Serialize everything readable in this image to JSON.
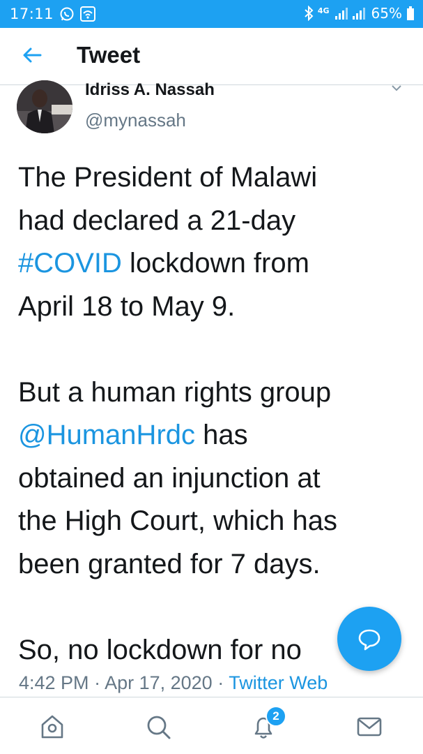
{
  "status_bar": {
    "time": "17:11",
    "network": "4G",
    "battery": "65%",
    "icons": [
      "whatsapp-icon",
      "wifi-icon",
      "bluetooth-icon",
      "signal-icon",
      "battery-icon"
    ]
  },
  "header": {
    "title": "Tweet",
    "back_icon": "back-arrow-icon"
  },
  "tweet": {
    "author": {
      "display_name": "Idriss A. Nassah",
      "handle": "@mynassah"
    },
    "body": {
      "p1_line1": "The President of Malawi",
      "p1_line2": "had declared a 21-day",
      "p1_hashtag": "#COVID",
      "p1_line3_rest": " lockdown from",
      "p1_line4": "April 18 to May 9.",
      "p2_line1": "But a human rights group",
      "p2_mention": "@HumanHrdc",
      "p2_line2_rest": " has",
      "p2_line3": "obtained an injunction at",
      "p2_line4": "the High Court, which has",
      "p2_line5": "been granted for 7 days.",
      "p3_line1": "So, no lockdown for no"
    },
    "time": "4:42 PM",
    "date": "Apr 17, 2020",
    "separator": " · ",
    "source": "Twitter Web"
  },
  "bottom_nav": {
    "items": [
      {
        "name": "home",
        "icon": "home-icon"
      },
      {
        "name": "search",
        "icon": "search-icon"
      },
      {
        "name": "notifications",
        "icon": "bell-icon"
      },
      {
        "name": "messages",
        "icon": "mail-icon"
      }
    ],
    "notifications_badge": "2"
  },
  "colors": {
    "accent": "#1da1f2",
    "link": "#1b95e0",
    "text": "#14171a",
    "secondary_text": "#657786"
  }
}
